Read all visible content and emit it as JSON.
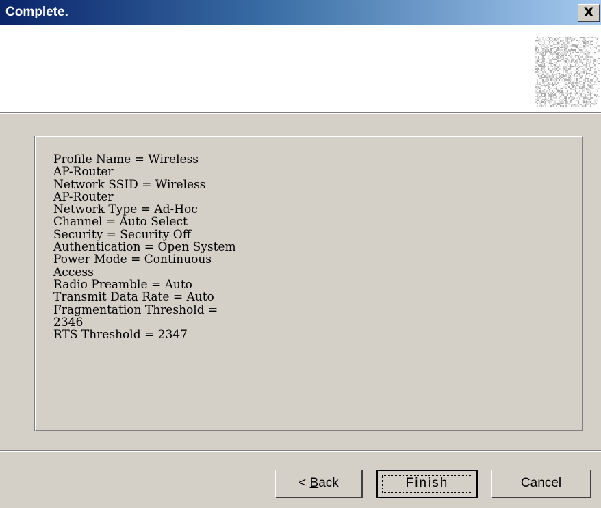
{
  "window": {
    "title": "Complete.",
    "close_glyph": "X"
  },
  "header": {
    "graphic_icon": "wireless-noise-graphic"
  },
  "summary": {
    "lines": [
      "Profile Name = Wireless",
      "AP-Router",
      "Network SSID = Wireless",
      "AP-Router",
      "Network Type = Ad-Hoc",
      "Channel = Auto Select",
      "Security = Security Off",
      "Authentication = Open System",
      "Power Mode = Continuous",
      "Access",
      "Radio Preamble = Auto",
      "Transmit Data Rate = Auto",
      "Fragmentation Threshold =",
      "2346",
      "RTS Threshold = 2347"
    ]
  },
  "buttons": {
    "back_prefix": "< ",
    "back_accel": "B",
    "back_rest": "ack",
    "finish": "Finish",
    "cancel": "Cancel"
  },
  "colors": {
    "face": "#d4d0c8",
    "title_start": "#0a246a",
    "title_end": "#a6caf0",
    "header_bg": "#ffffff"
  }
}
